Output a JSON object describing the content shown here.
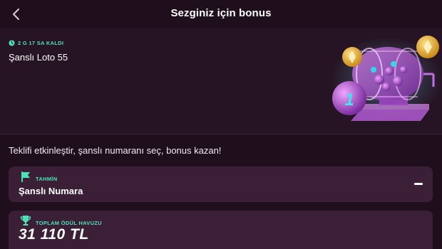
{
  "header": {
    "title": "Sezginiz için bonus",
    "back_icon": "chevron-left-icon"
  },
  "hero": {
    "timer": "2 G 17 SA KALDI",
    "timer_icon": "clock-icon",
    "title": "Şanslı Loto 55",
    "illustration": "lottery-machine"
  },
  "main": {
    "subtitle": "Teklifi etkinleştir, şanslı numaranı seç, bonus kazan!",
    "prediction_card": {
      "label": "TAHMİN",
      "icon": "flag-icon",
      "value": "Şanslı Numara",
      "toggle_icon": "minus-icon"
    },
    "prize_card": {
      "label": "TOPLAM ÖDÜL HAVUZU",
      "icon": "trophy-icon",
      "value": "31 110 TL"
    }
  },
  "colors": {
    "background": "#1f0e1c",
    "hero_background": "#261424",
    "card_background": "#3a1f36",
    "accent": "#4ee0b7",
    "text": "#ffffff"
  }
}
